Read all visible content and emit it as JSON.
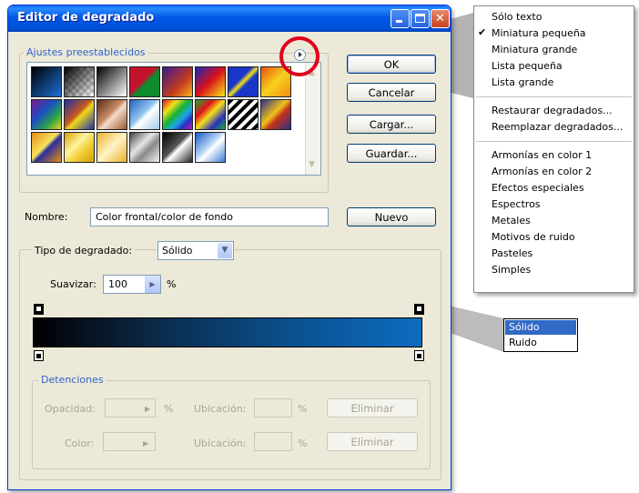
{
  "dialog": {
    "title": "Editor de degradado",
    "presets_label": "Ajustes preestablecidos",
    "ok": "OK",
    "cancel": "Cancelar",
    "load": "Cargar...",
    "save": "Guardar...",
    "name_label": "Nombre:",
    "name_value": "Color frontal/color de fondo",
    "new": "Nuevo",
    "gradient_type_label": "Tipo de degradado:",
    "gradient_type_value": "Sólido",
    "smooth_label": "Suavizar:",
    "smooth_value": "100",
    "smooth_unit": "%",
    "stops_label": "Detenciones",
    "opacity_label": "Opacidad:",
    "opacity_unit": "%",
    "location_label": "Ubicación:",
    "location_unit": "%",
    "delete": "Eliminar",
    "color_label": "Color:",
    "location_label_2": "Ubicación:",
    "location_unit_2": "%",
    "delete_2": "Eliminar"
  },
  "preset_swatches": [
    {
      "css": "linear-gradient(135deg,#000 0%,#1d6fd6 100%)"
    },
    {
      "css": "linear-gradient(135deg,#000 0%,rgba(0,0,0,0) 100%),repeating-conic-gradient(#ccc 0 25%,#fff 0 50%) 0 0/8px 8px"
    },
    {
      "css": "linear-gradient(135deg,#000 0%,#fff 100%)"
    },
    {
      "css": "linear-gradient(135deg,#c4122d 0%,#c4122d 45%,#108a2e 55%,#108a2e 100%)"
    },
    {
      "css": "linear-gradient(135deg,#3b1a8e 0%,#c23a1f 60%,#f8b21b 100%)"
    },
    {
      "css": "linear-gradient(135deg,#1b24b5 0%,#d9121a 50%,#f7ea19 100%)"
    },
    {
      "css": "linear-gradient(135deg,#1836c7 0%,#1836c7 40%,#f6e316 50%,#1836c7 60%,#1836c7 100%)"
    },
    {
      "css": "linear-gradient(135deg,#e8520f 0%,#f7d11e 50%,#f08c10 100%)"
    },
    {
      "css": "linear-gradient(135deg,#7a1b8f 0%,#1b4fbf 40%,#2aa34b 70%,#f4d016 100%)"
    },
    {
      "css": "linear-gradient(135deg,#1c2fa8 0%,#c6581d 45%,#f1d81d 55%,#1c2fa8 100%)"
    },
    {
      "css": "linear-gradient(135deg,#5a2b14 0%,#c78c66 45%,#f4dbc8 55%,#9b5a34 100%)"
    },
    {
      "css": "linear-gradient(135deg,#2861c4 0%,#8fc6ee 45%,#ffffff 55%,#9ec9e8 100%)"
    },
    {
      "css": "linear-gradient(135deg,#e0111d 0%,#f2e21b 25%,#18b431 45%,#1aa6e6 65%,#2a2fc1 80%,#c61ab0 100%)"
    },
    {
      "css": "linear-gradient(135deg,#1fae2f 0%,#e0111d 30%,#f2e21b 50%,#2a2fc1 75%,#18b431 100%)"
    },
    {
      "css": "repeating-linear-gradient(135deg,#000 0 4px,#fff 4px 8px)"
    },
    {
      "css": "linear-gradient(135deg,#2a2f8c 0%,#f0c21a 45%,#c5331b 60%,#2a2f8c 100%)"
    },
    {
      "css": "linear-gradient(135deg,#e48f17 0%,#f7e25e 45%,#2a2e9c 55%,#e48f17 100%)"
    },
    {
      "css": "linear-gradient(135deg,#d4a300 0%,#fff3a0 40%,#f2d341 60%,#d4a300 100%)"
    },
    {
      "css": "linear-gradient(135deg,#e8b428 0%,#fff2c6 50%,#e8b428 100%)"
    },
    {
      "css": "linear-gradient(135deg,#444 0%,#e6e6e6 40%,#8a8a8a 60%,#f2f2f2 100%)"
    },
    {
      "css": "linear-gradient(135deg,#000 0%,#555 45%,#fff 55%,#222 100%)"
    },
    {
      "css": "linear-gradient(135deg,#1b58c6 0%,#b8d6f5 45%,#ffffff 55%,#3a7bd6 100%)"
    }
  ],
  "context_menu": {
    "items": [
      {
        "label": "Sólo texto",
        "checked": false
      },
      {
        "label": "Miniatura pequeña",
        "checked": true
      },
      {
        "label": "Miniatura grande",
        "checked": false
      },
      {
        "label": "Lista pequeña",
        "checked": false
      },
      {
        "label": "Lista grande",
        "checked": false
      },
      {
        "label": "Restaurar degradados...",
        "checked": false
      },
      {
        "label": "Reemplazar degradados...",
        "checked": false
      },
      {
        "label": "Armonías en color 1",
        "checked": false
      },
      {
        "label": "Armonías en color 2",
        "checked": false
      },
      {
        "label": "Efectos especiales",
        "checked": false
      },
      {
        "label": "Espectros",
        "checked": false
      },
      {
        "label": "Metales",
        "checked": false
      },
      {
        "label": "Motivos de ruido",
        "checked": false
      },
      {
        "label": "Pasteles",
        "checked": false
      },
      {
        "label": "Simples",
        "checked": false
      }
    ],
    "check_mark": "✔"
  },
  "type_options": {
    "selected": "Sólido",
    "other": "Ruido"
  },
  "colors": {
    "titlebar": "#0058e6",
    "dialog_bg": "#ece9d8",
    "highlight_ring": "#e0001b",
    "selection": "#316ac5"
  }
}
